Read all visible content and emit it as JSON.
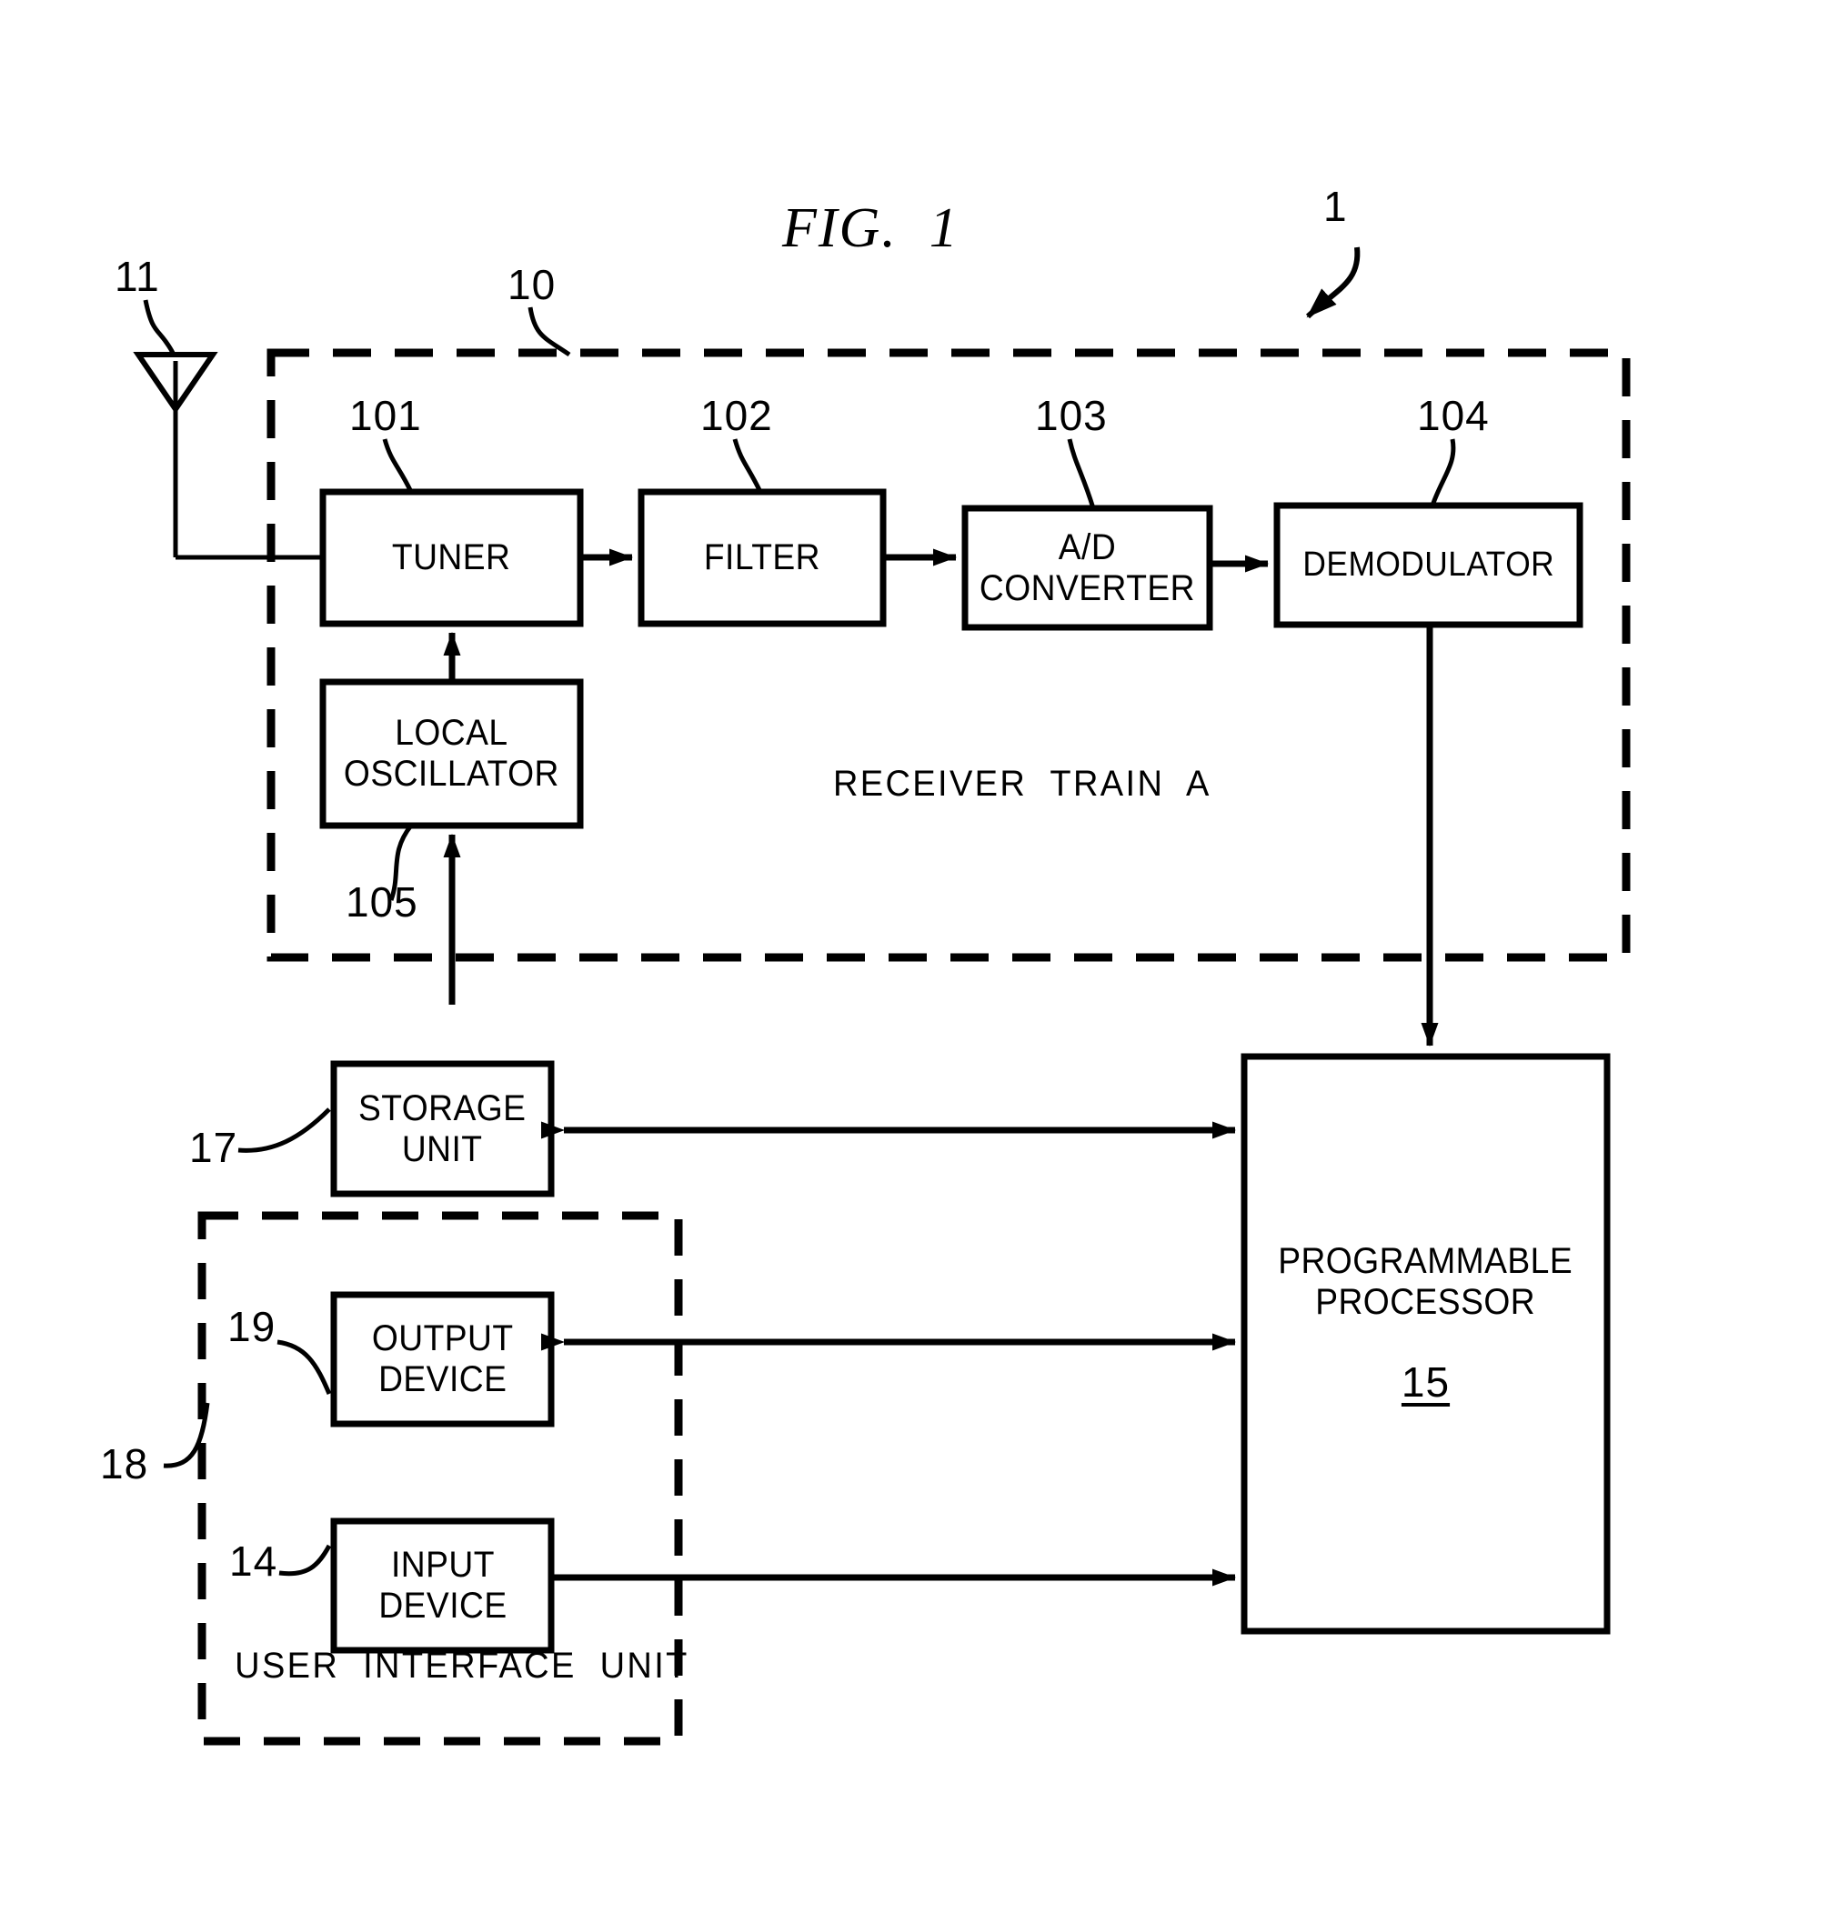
{
  "figure": {
    "title": "FIG.  1",
    "system_ref": "1"
  },
  "refs": {
    "antenna": "11",
    "receiver_unit": "10",
    "tuner": "101",
    "filter": "102",
    "ad_converter": "103",
    "demodulator": "104",
    "local_oscillator": "105",
    "storage_unit": "17",
    "user_interface_unit": "18",
    "output_device": "19",
    "input_device": "14",
    "programmable_processor": "15"
  },
  "blocks": {
    "tuner": "TUNER",
    "filter": "FILTER",
    "ad_converter": "A/D\nCONVERTER",
    "demodulator": "DEMODULATOR",
    "local_oscillator": "LOCAL\nOSCILLATOR",
    "storage_unit": "STORAGE\nUNIT",
    "output_device": "OUTPUT\nDEVICE",
    "input_device": "INPUT\nDEVICE",
    "programmable_processor": "PROGRAMMABLE\nPROCESSOR"
  },
  "area_labels": {
    "receiver_train": "RECEIVER  TRAIN  A",
    "user_interface_unit": "USER  INTERFACE  UNIT"
  },
  "colors": {
    "ink": "#000000",
    "paper": "#ffffff"
  }
}
